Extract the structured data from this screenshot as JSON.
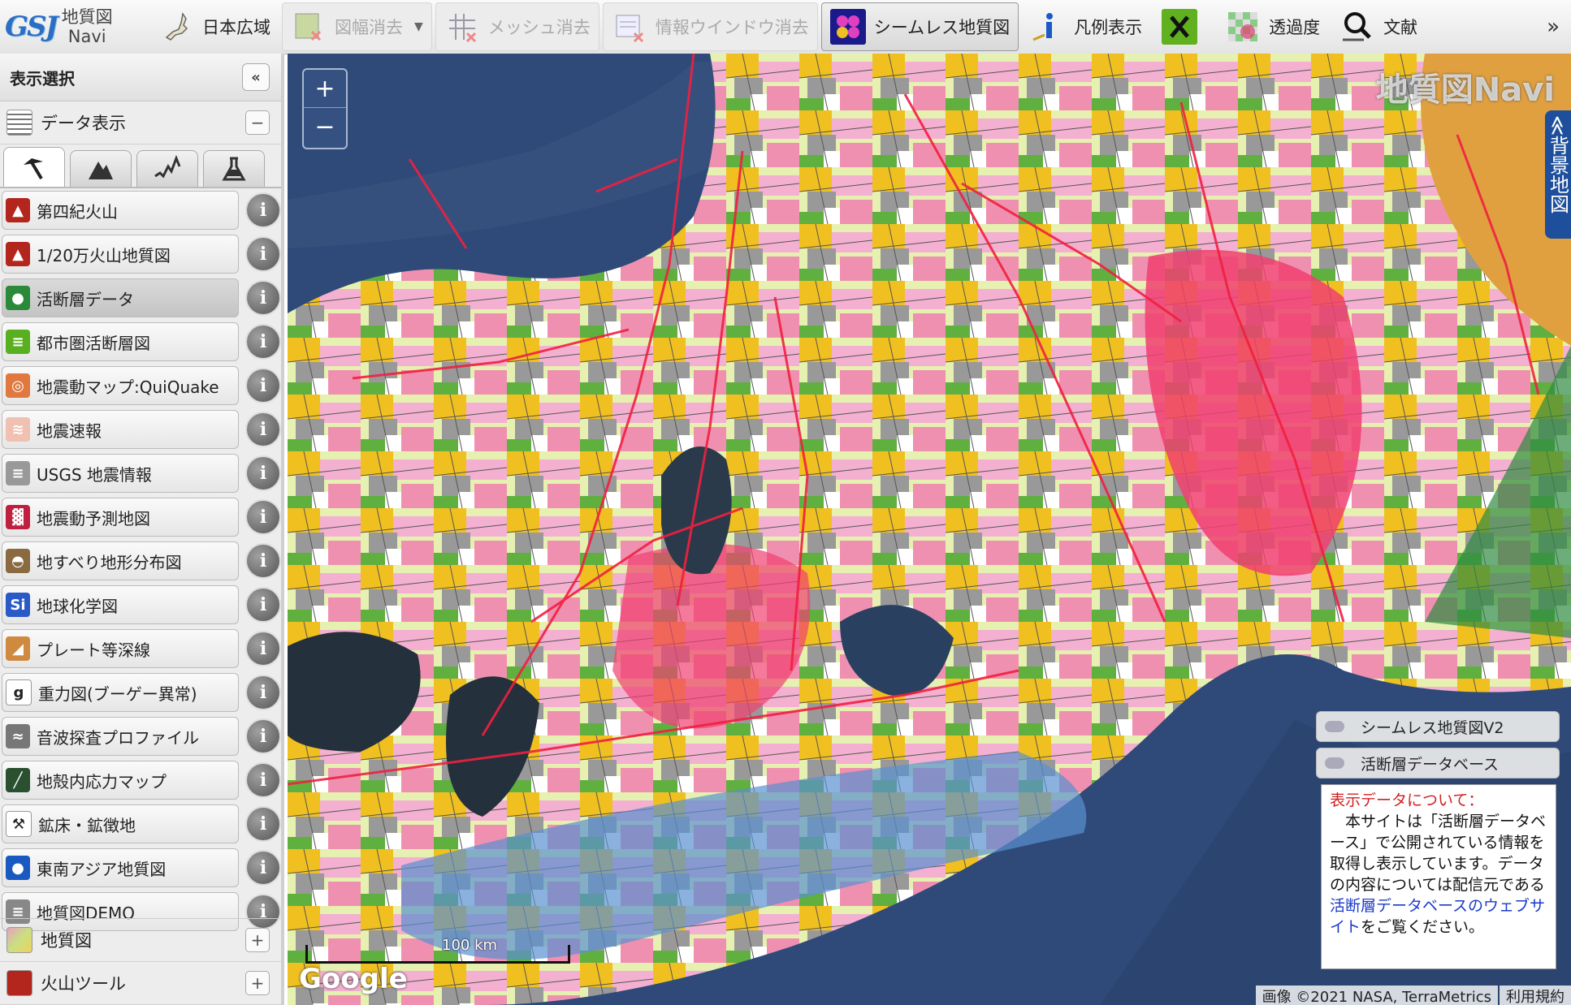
{
  "toolbar": {
    "logo_mark": "GSJ",
    "logo_line1": "地質図",
    "logo_line2": "Navi",
    "japan_label": "日本広域",
    "sheet_clear_label": "図幅消去",
    "mesh_clear_label": "メッシュ消去",
    "info_window_clear_label": "情報ウインドウ消去",
    "seamless_label": "シームレス地質図",
    "legend_label": "凡例表示",
    "transparency_label": "透過度",
    "literature_label": "文献",
    "more_label": "»"
  },
  "sidebar": {
    "title": "表示選択",
    "collapse_label": "«",
    "data_section": "データ表示",
    "data_section_btn": "−",
    "items": [
      {
        "label": "第四紀火山",
        "color": "#b3261e",
        "glyph": "▲"
      },
      {
        "label": "1/20万火山地質図",
        "color": "#b3261e",
        "glyph": "▲"
      },
      {
        "label": "活断層データ",
        "color": "#2a8a3a",
        "glyph": "●"
      },
      {
        "label": "都市圏活断層図",
        "color": "#58b020",
        "glyph": "≡"
      },
      {
        "label": "地震動マップ:QuiQuake",
        "color": "#e07840",
        "glyph": "◎"
      },
      {
        "label": "地震速報",
        "color": "#f0c0b0",
        "glyph": "≋"
      },
      {
        "label": "USGS 地震情報",
        "color": "#999999",
        "glyph": "≡"
      },
      {
        "label": "地震動予測地図",
        "color": "#c02040",
        "glyph": "▓"
      },
      {
        "label": "地すべり地形分布図",
        "color": "#8a6a40",
        "glyph": "◓"
      },
      {
        "label": "地球化学図",
        "color": "#2a5ac8",
        "glyph": "Si"
      },
      {
        "label": "プレート等深線",
        "color": "#d08a40",
        "glyph": "◢"
      },
      {
        "label": "重力図(ブーゲー異常)",
        "color": "#ffffff",
        "glyph": "g"
      },
      {
        "label": "音波探査プロファイル",
        "color": "#777777",
        "glyph": "≈"
      },
      {
        "label": "地殻内応力マップ",
        "color": "#2a5030",
        "glyph": "╱"
      },
      {
        "label": "鉱床・鉱徴地",
        "color": "#ffffff",
        "glyph": "⚒"
      },
      {
        "label": "東南アジア地質図",
        "color": "#1a5ac0",
        "glyph": "●"
      },
      {
        "label": "地質図DEMO",
        "color": "#888888",
        "glyph": "≡"
      }
    ],
    "geology_section": "地質図",
    "volcano_section": "火山ツール",
    "plus_label": "+"
  },
  "map": {
    "zoom_in": "+",
    "zoom_out": "−",
    "watermark": "地質図Navi",
    "background_tab": "≪背景地図",
    "legend_seamless": "シームレス地質図V2",
    "legend_fault_db": "活断層データベース",
    "info_title": "表示データについて：",
    "info_body": "　本サイトは「活断層データベース」で公開されている情報を取得し表示しています。データの内容については配信元である",
    "info_link": "活断層データベースのウェブサイト",
    "info_tail": "をご覧ください。",
    "scale_label": "100 km",
    "google": "Google",
    "attribution": "画像 ©2021 NASA, TerraMetrics",
    "terms": "利用規約"
  }
}
